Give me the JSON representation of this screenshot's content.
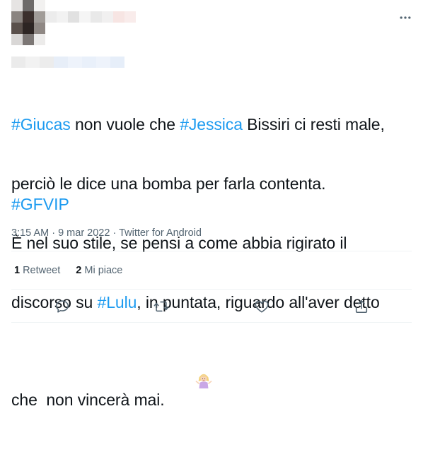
{
  "tweet": {
    "author": {
      "avatar_pixels": [
        "#e6e4e3",
        "#6d6a69",
        "#f2f1f0",
        "#8a8480",
        "#3b2f2c",
        "#a19c98",
        "#5a504b",
        "#2d2523",
        "#8f8884",
        "#d9d7d6",
        "#7c7775",
        "#ecebea"
      ],
      "name_pixels": [
        "#ececec",
        "#f2f2f2",
        "#e1e1e1",
        "#f5f5f5",
        "#e9e9e9",
        "#f1f0f0",
        "#f7e5e3",
        "#f9eceb"
      ],
      "handle_pixels": [
        "#ebebeb",
        "#f2f2f2",
        "#ececec",
        "#e7eef8",
        "#eef3fb",
        "#e9f0fa",
        "#eef3fb",
        "#e6eef9"
      ]
    },
    "text": {
      "line1_tag1": "#Giucas",
      "line1_mid": " non vuole che ",
      "line1_tag2": "#Jessica",
      "line1_end": " Bissiri ci resti male,",
      "line2": "perciò le dice una bomba per farla contenta.",
      "line3": "È nel suo stile, se pensi a come abbia rigirato il",
      "line4_start": "discorso su ",
      "line4_tag": "#Lulu",
      "line4_end": ", in puntata, riguardo all'aver detto",
      "line5": "che  non vincerà mai.",
      "emoji": "person-shrugging-emoji"
    },
    "hashtags_line": "#GFVIP",
    "timestamp": "3:15 AM · 9 mar 2022 · ",
    "source": "Twitter for Android",
    "stats": {
      "retweets_count": "1",
      "retweets_label": "Retweet",
      "likes_count": "2",
      "likes_label": "Mi piace"
    },
    "actions": {
      "reply_icon": "reply-icon",
      "retweet_icon": "retweet-icon",
      "like_icon": "like-icon",
      "share_icon": "share-icon",
      "more_icon": "more-icon"
    },
    "colors": {
      "hashtag": "#1d9bf0",
      "text": "#0f1419",
      "secondary": "#536471",
      "divider": "#eff3f4"
    }
  }
}
